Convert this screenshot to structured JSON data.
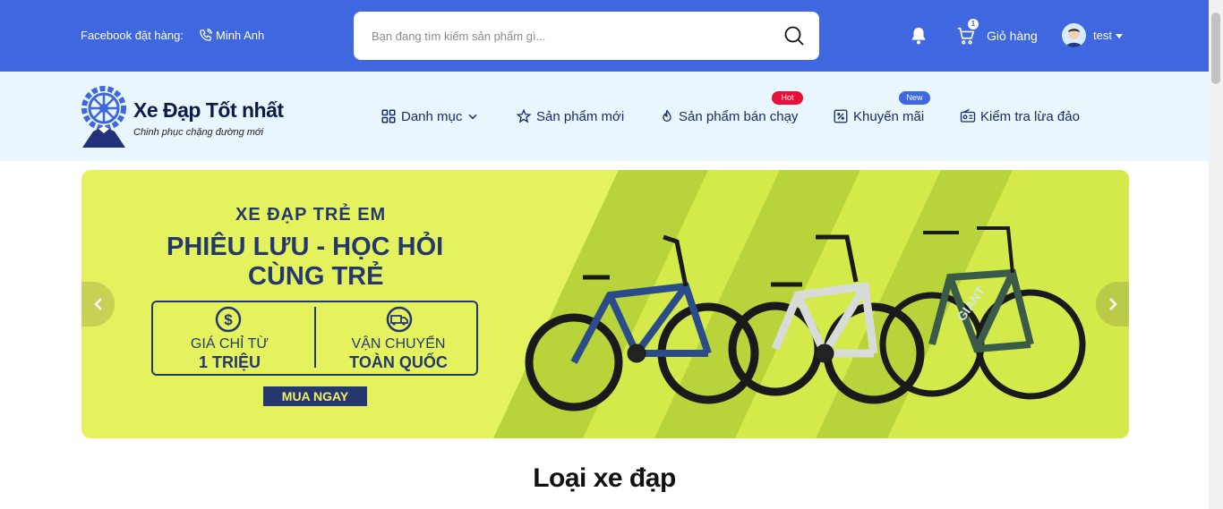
{
  "topbar": {
    "facebook_label": "Facebook đặt hàng:",
    "contact_name": "Minh Anh",
    "search_placeholder": "Bạn đang tìm kiếm sản phẩm gì...",
    "cart_count": "1",
    "cart_label": "Giỏ hàng",
    "username": "test"
  },
  "brand": {
    "title": "Xe Đạp Tốt nhất",
    "tagline": "Chinh phục chặng đường mới"
  },
  "nav": [
    {
      "label": "Danh mục"
    },
    {
      "label": "Sản phẩm mới"
    },
    {
      "label": "Sản phẩm bán chạy",
      "badge": "Hot"
    },
    {
      "label": "Khuyến mãi",
      "badge": "New"
    },
    {
      "label": "Kiểm tra lừa đảo"
    }
  ],
  "banner": {
    "subtitle": "XE ĐẠP TRẺ EM",
    "title_line1": "PHIÊU LƯU - HỌC HỎI",
    "title_line2": "CÙNG TRẺ",
    "price_label": "GIÁ CHỈ TỪ",
    "price_value": "1 TRIỆU",
    "shipping_label": "VẬN CHUYỂN",
    "shipping_value": "TOÀN QUỐC",
    "cta": "MUA NGAY",
    "bike_brand": "GIANT"
  },
  "colors": {
    "primary": "#3f67e0",
    "navy": "#25386e",
    "banner_bg": "#e4f35d",
    "hot": "#e8103b"
  },
  "section": {
    "title": "Loại xe đạp"
  }
}
